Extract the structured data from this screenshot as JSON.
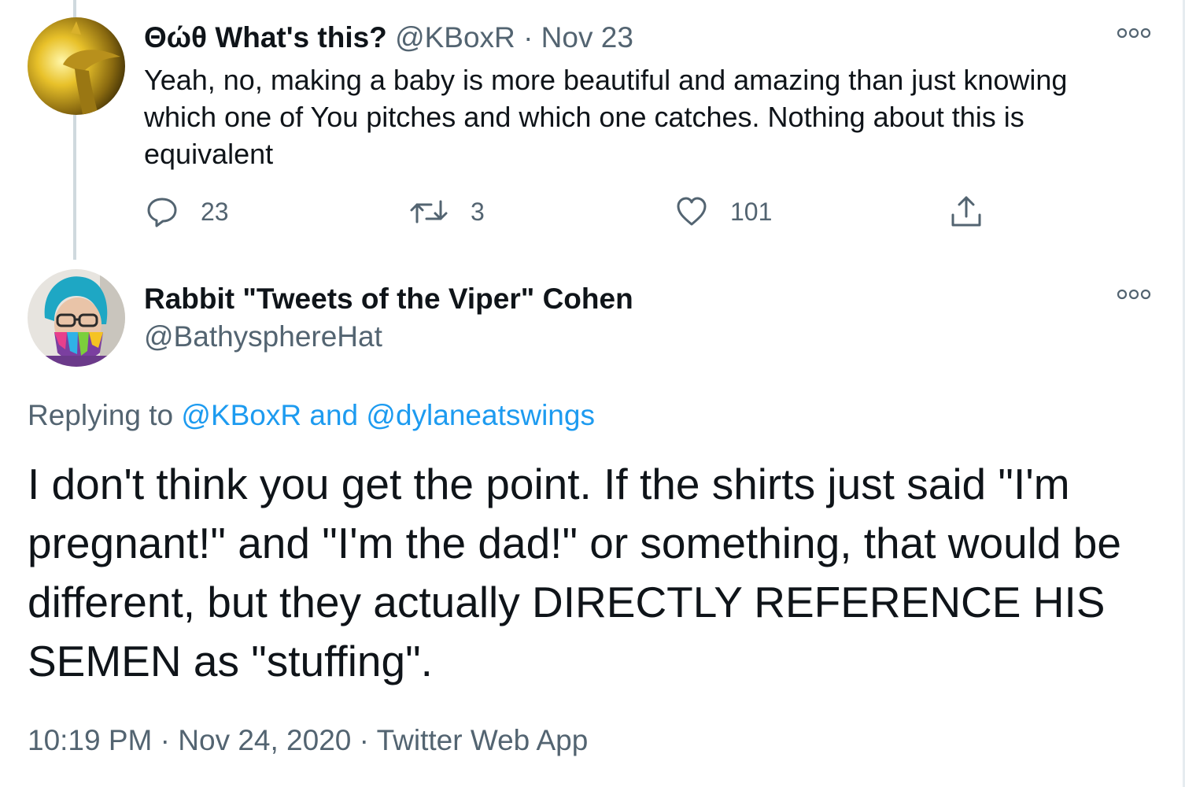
{
  "tweet1": {
    "display_name": "Θώθ What's this?",
    "handle": "@KBoxR",
    "separator": "·",
    "date": "Nov 23",
    "text": "Yeah, no, making a baby is more beautiful and amazing than just knowing which one of You pitches and which one catches. Nothing about this is equivalent",
    "reply_count": "23",
    "retweet_count": "3",
    "like_count": "101"
  },
  "tweet2": {
    "display_name": "Rabbit \"Tweets of the Viper\" Cohen",
    "handle": "@BathysphereHat",
    "replying_prefix": "Replying to",
    "reply_to_1": "@KBoxR",
    "reply_and": "and",
    "reply_to_2": "@dylaneatswings",
    "text": "I don't think you get the point. If the shirts just said \"I'm pregnant!\" and \"I'm the dad!\" or something, that would be different, but they actually DIRECTLY REFERENCE HIS SEMEN as \"stuffing\".",
    "time": "10:19 PM",
    "separator": "·",
    "date": "Nov 24, 2020",
    "source": "Twitter Web App"
  },
  "icons": {
    "more": "more-icon",
    "reply": "reply-icon",
    "retweet": "retweet-icon",
    "like": "heart-icon",
    "share": "share-icon"
  },
  "colors": {
    "text": "#0f1419",
    "muted": "#536471",
    "link": "#1d9bf0",
    "thread_line": "#cfd9de"
  }
}
